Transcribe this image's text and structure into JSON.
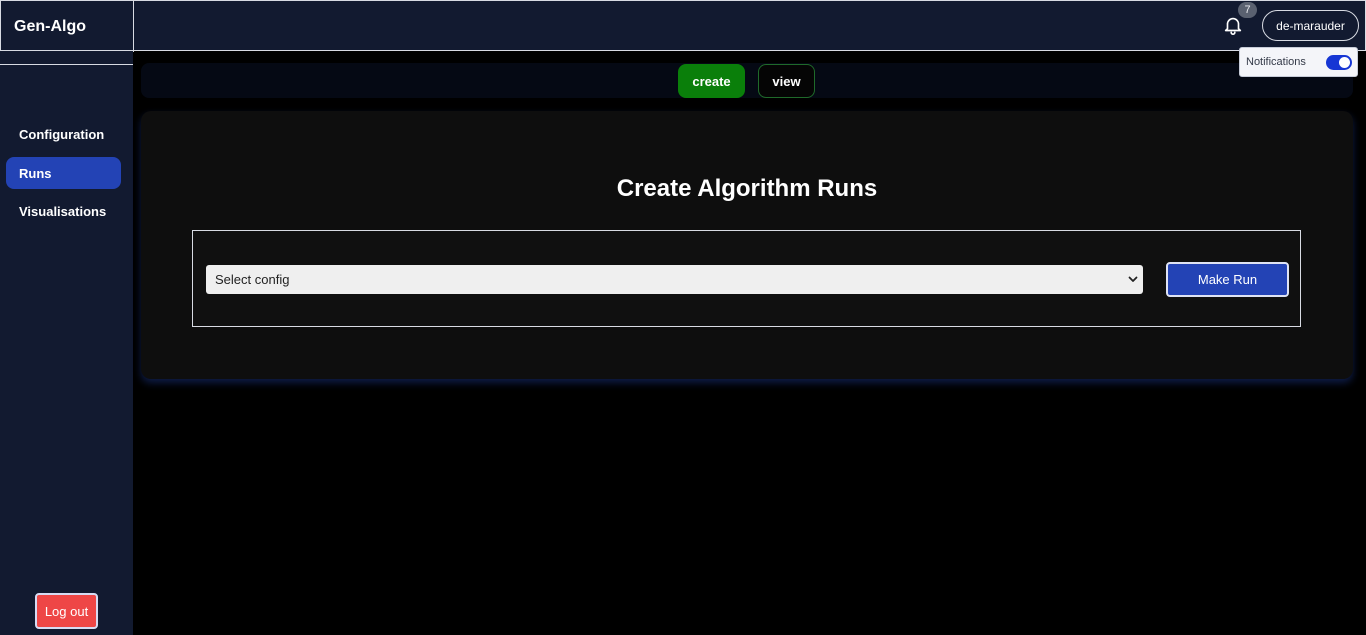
{
  "app": {
    "brand": "Gen-Algo"
  },
  "header": {
    "notification_count": "7",
    "username": "de-marauder",
    "notifications_popover": {
      "label": "Notifications",
      "enabled": true
    }
  },
  "sidebar": {
    "items": [
      {
        "label": "Configuration",
        "active": false
      },
      {
        "label": "Runs",
        "active": true
      },
      {
        "label": "Visualisations",
        "active": false
      }
    ],
    "logout_label": "Log out"
  },
  "tabs": [
    {
      "label": "create",
      "active": true
    },
    {
      "label": "view",
      "active": false
    }
  ],
  "main": {
    "title": "Create Algorithm Runs",
    "config_select": {
      "selected": "Select config"
    },
    "make_run_label": "Make Run"
  },
  "colors": {
    "header_bg": "#121a30",
    "accent_blue": "#2343b5",
    "create_green": "#0a7f0a",
    "logout_red": "#ee4646",
    "toggle_blue": "#1636d4"
  }
}
